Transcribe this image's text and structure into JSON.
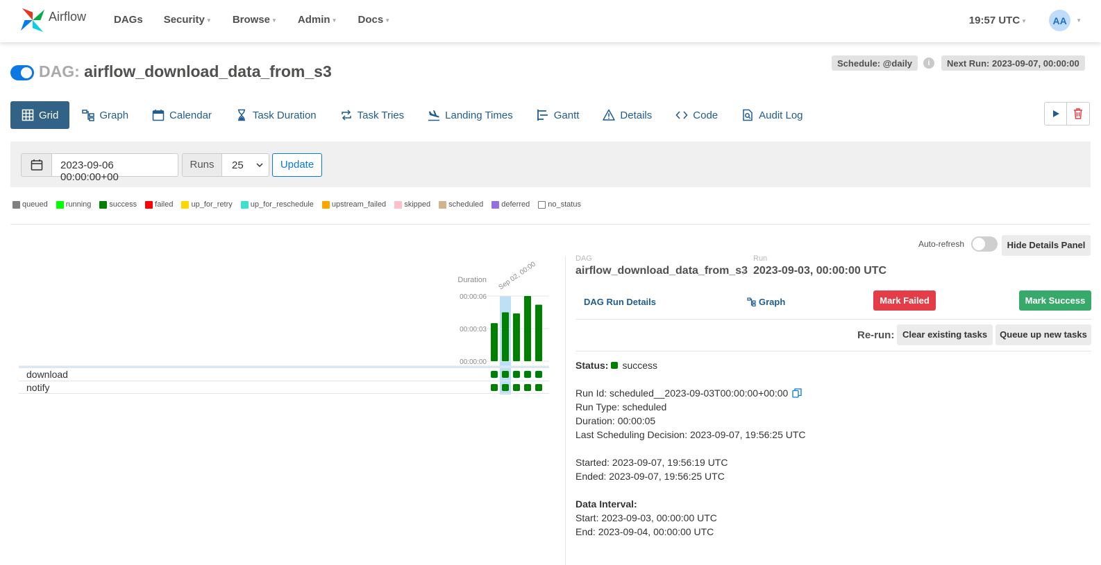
{
  "navbar": {
    "brand": "Airflow",
    "menu": [
      {
        "label": "DAGs",
        "dropdown": false
      },
      {
        "label": "Security",
        "dropdown": true
      },
      {
        "label": "Browse",
        "dropdown": true
      },
      {
        "label": "Admin",
        "dropdown": true
      },
      {
        "label": "Docs",
        "dropdown": true
      }
    ],
    "clock": "19:57 UTC",
    "avatar": "AA"
  },
  "dag": {
    "prefix": "DAG:",
    "name": "airflow_download_data_from_s3",
    "schedule": "Schedule: @daily",
    "next_run": "Next Run: 2023-09-07, 00:00:00",
    "paused": false
  },
  "tabs": [
    {
      "label": "Grid",
      "icon": "grid-icon"
    },
    {
      "label": "Graph",
      "icon": "graph-icon"
    },
    {
      "label": "Calendar",
      "icon": "calendar-icon"
    },
    {
      "label": "Task Duration",
      "icon": "hourglass-icon"
    },
    {
      "label": "Task Tries",
      "icon": "repeat-icon"
    },
    {
      "label": "Landing Times",
      "icon": "plane-landing-icon"
    },
    {
      "label": "Gantt",
      "icon": "gantt-icon"
    },
    {
      "label": "Details",
      "icon": "warning-triangle-icon"
    },
    {
      "label": "Code",
      "icon": "code-icon"
    },
    {
      "label": "Audit Log",
      "icon": "file-search-icon"
    }
  ],
  "filter": {
    "base_date": "2023-09-06 00:00:00+00",
    "runs_label": "Runs",
    "runs_value": "25",
    "update_label": "Update"
  },
  "legend": [
    {
      "label": "queued",
      "color": "#808080"
    },
    {
      "label": "running",
      "color": "#00ff00"
    },
    {
      "label": "success",
      "color": "#008000"
    },
    {
      "label": "failed",
      "color": "#ff0000"
    },
    {
      "label": "up_for_retry",
      "color": "#ffd700"
    },
    {
      "label": "up_for_reschedule",
      "color": "#40e0d0"
    },
    {
      "label": "upstream_failed",
      "color": "#ffa500"
    },
    {
      "label": "skipped",
      "color": "#ffc0cb"
    },
    {
      "label": "scheduled",
      "color": "#d2b48c"
    },
    {
      "label": "deferred",
      "color": "#9370db"
    },
    {
      "label": "no_status",
      "color": "#ffffff"
    }
  ],
  "grid": {
    "duration_label": "Duration",
    "date_label": "Sep 02, 00:00",
    "tasks": [
      "download",
      "notify"
    ]
  },
  "chart_data": {
    "type": "bar",
    "ylabel": "Duration",
    "y_ticks": [
      "00:00:06",
      "00:00:03",
      "00:00:00"
    ],
    "ylim_seconds": [
      0,
      6
    ],
    "runs_duration_seconds": [
      3.5,
      4.5,
      4.4,
      6.0,
      5.2
    ],
    "selected_run_index": 1,
    "task_states": {
      "download": [
        "success",
        "success",
        "success",
        "success",
        "success"
      ],
      "notify": [
        "success",
        "success",
        "success",
        "success",
        "success"
      ]
    }
  },
  "details": {
    "auto_refresh": "Auto-refresh",
    "hide_panel": "Hide Details Panel",
    "dag_label": "DAG",
    "dag_value": "airflow_download_data_from_s3",
    "run_label": "Run",
    "run_value": "2023-09-03, 00:00:00 UTC",
    "sep": "/",
    "dag_run_details": "DAG Run Details",
    "graph": "Graph",
    "mark_failed": "Mark Failed",
    "mark_success": "Mark Success",
    "rerun": "Re-run:",
    "clear_existing": "Clear existing tasks",
    "queue_new": "Queue up new tasks",
    "status_label": "Status:",
    "status_value": "success",
    "run_id": "Run Id: scheduled__2023-09-03T00:00:00+00:00",
    "run_type": "Run Type: scheduled",
    "duration": "Duration: 00:00:05",
    "last_sched": "Last Scheduling Decision: 2023-09-07, 19:56:25 UTC",
    "started": "Started: 2023-09-07, 19:56:19 UTC",
    "ended": "Ended: 2023-09-07, 19:56:25 UTC",
    "interval_label": "Data Interval:",
    "interval_start": "Start: 2023-09-03, 00:00:00 UTC",
    "interval_end": "End: 2023-09-04, 00:00:00 UTC"
  }
}
